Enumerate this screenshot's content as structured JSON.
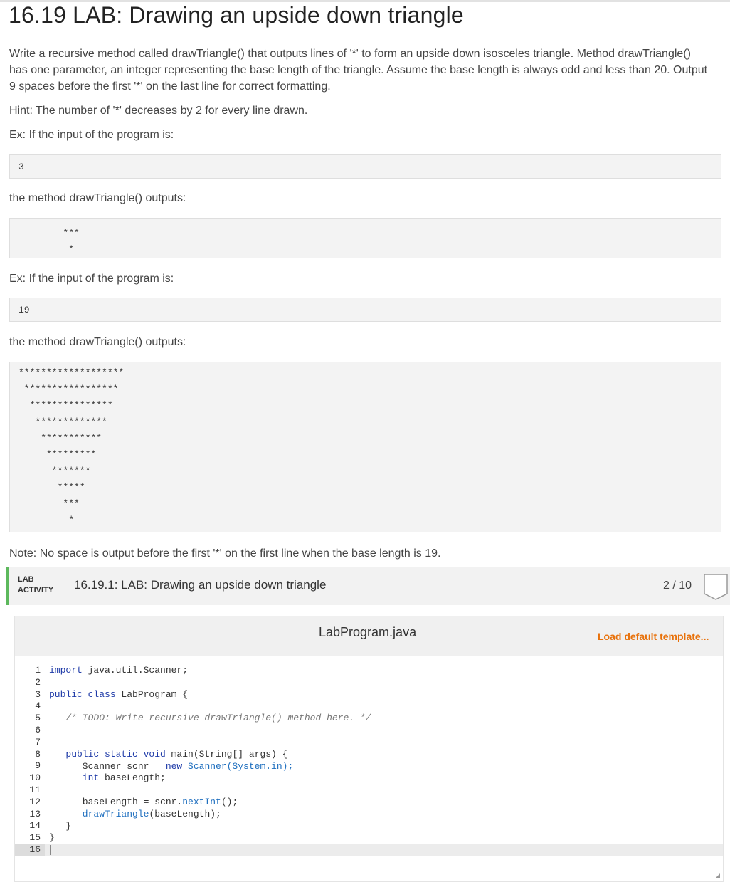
{
  "title": "16.19 LAB: Drawing an upside down triangle",
  "description": {
    "line1": "Write a recursive method called drawTriangle() that outputs lines of '*' to form an upside down isosceles triangle. Method drawTriangle()",
    "line2": "has one parameter, an integer representing the base length of the triangle. Assume the base length is always odd and less than 20. Output",
    "line3": "9 spaces before the first '*' on the last line for correct formatting."
  },
  "hint": "Hint: The number of '*' decreases by 2 for every line drawn.",
  "example1": {
    "intro": "Ex: If the input of the program is:",
    "input": "3",
    "output_intro": "the method drawTriangle() outputs:",
    "output_lines": [
      "        ***",
      "         *"
    ]
  },
  "example2": {
    "intro": "Ex: If the input of the program is:",
    "input": "19",
    "output_intro": "the method drawTriangle() outputs:",
    "output_lines": [
      "*******************",
      " *****************",
      "  ***************",
      "   *************",
      "    ***********",
      "     *********",
      "      *******",
      "       *****",
      "        ***",
      "         *"
    ]
  },
  "note": "Note: No space is output before the first '*' on the first line when the base length is 19.",
  "lab": {
    "tag_line1": "LAB",
    "tag_line2": "ACTIVITY",
    "title": "16.19.1: LAB: Drawing an upside down triangle",
    "score": "2 / 10"
  },
  "editor": {
    "file_name": "LabProgram.java",
    "load_template": "Load default template...",
    "line_numbers": [
      "1",
      "2",
      "3",
      "4",
      "5",
      "6",
      "7",
      "8",
      "9",
      "10",
      "11",
      "12",
      "13",
      "14",
      "15",
      "16"
    ],
    "code": {
      "l1_kw": "import",
      "l1_rest": " java.util.Scanner;",
      "l3_kw": "public class",
      "l3_rest": " LabProgram {",
      "l5_comment": "   /* TODO: Write recursive drawTriangle() method here. */",
      "l8_kw": "   public static void",
      "l8_rest": " main(String[] args) {",
      "l9_a": "      Scanner scnr = ",
      "l9_kw": "new",
      "l9_b": " Scanner(System.in);",
      "l10_kw": "      int",
      "l10_rest": " baseLength;",
      "l12_a": "      baseLength = scnr.",
      "l12_fn": "nextInt",
      "l12_b": "();",
      "l13_fn": "      drawTriangle",
      "l13_rest": "(baseLength);",
      "l14": "   }",
      "l15": "}"
    }
  }
}
